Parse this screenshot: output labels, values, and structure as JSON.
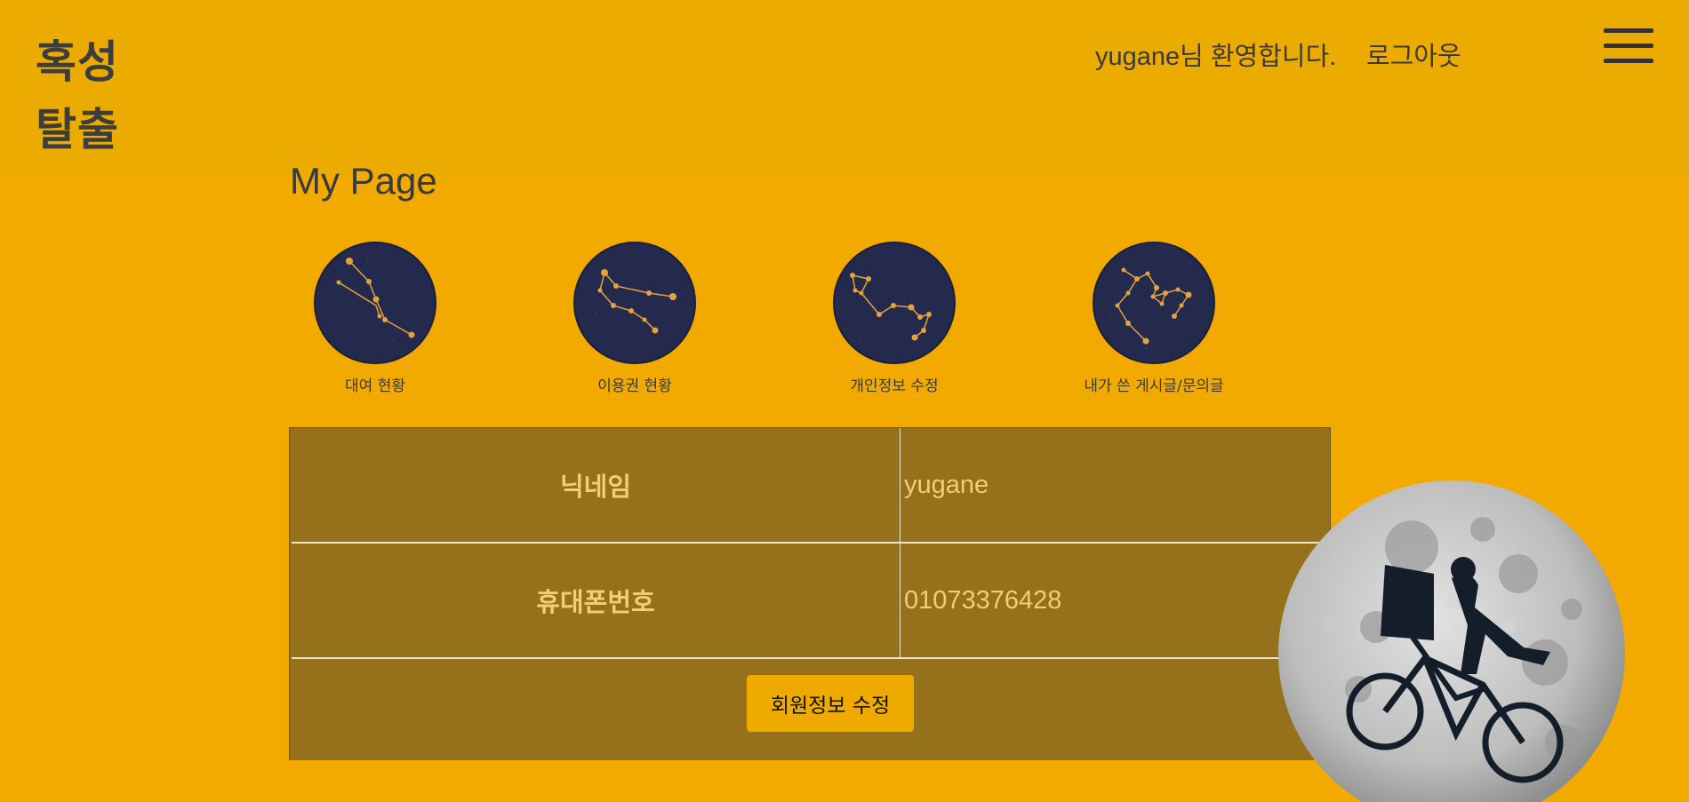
{
  "header": {
    "logo_line1": "혹성",
    "logo_line2": "탈출",
    "welcome": "yugane님 환영합니다.",
    "logout": "로그아웃"
  },
  "page_title": "My Page",
  "menu": [
    {
      "label": "대여 현황",
      "icon": "constellation-icon"
    },
    {
      "label": "이용권 현황",
      "icon": "constellation-icon"
    },
    {
      "label": "개인정보 수정",
      "icon": "constellation-icon"
    },
    {
      "label": "내가 쓴 게시글/문의글",
      "icon": "constellation-icon"
    }
  ],
  "info": {
    "nickname_label": "닉네임",
    "nickname_value": "yugane",
    "phone_label": "휴대폰번호",
    "phone_value": "01073376428"
  },
  "edit_button": "회원정보 수정",
  "colors": {
    "background": "#f2aa00",
    "header": "#ebab00",
    "panel": "#95711c",
    "panel_text": "#f4cc76",
    "circle": "#232a4d",
    "star": "#e6a23a"
  }
}
